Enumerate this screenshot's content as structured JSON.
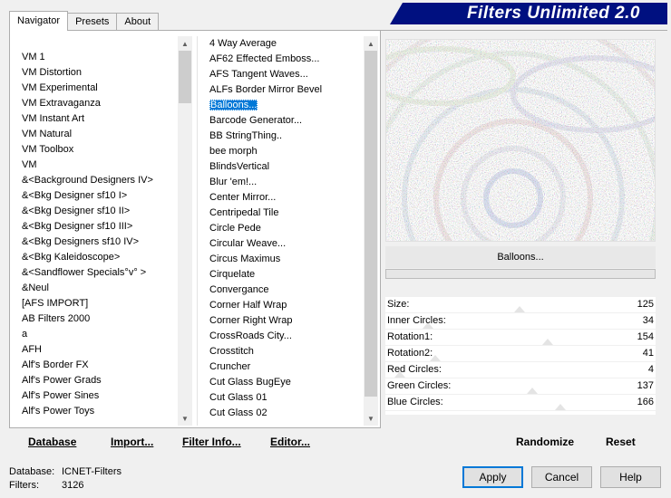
{
  "tabs": [
    "Navigator",
    "Presets",
    "About"
  ],
  "banner": "Filters Unlimited 2.0",
  "categories": [
    "VM 1",
    "VM Distortion",
    "VM Experimental",
    "VM Extravaganza",
    "VM Instant Art",
    "VM Natural",
    "VM Toolbox",
    "VM",
    "&<Background Designers IV>",
    "&<Bkg Designer sf10 I>",
    "&<Bkg Designer sf10 II>",
    "&<Bkg Designer sf10 III>",
    "&<Bkg Designers sf10 IV>",
    "&<Bkg Kaleidoscope>",
    "&<Sandflower Specials°v° >",
    "&Neul",
    "[AFS IMPORT]",
    "AB Filters 2000",
    "a",
    "AFH",
    "Alf's Border FX",
    "Alf's Power Grads",
    "Alf's Power Sines",
    "Alf's Power Toys"
  ],
  "filters": [
    "4 Way Average",
    "AF62 Effected Emboss...",
    "AFS Tangent Waves...",
    "ALFs Border Mirror Bevel",
    "Balloons...",
    "Barcode Generator...",
    "BB StringThing..",
    "bee morph",
    "BlindsVertical",
    "Blur 'em!...",
    "Center Mirror...",
    "Centripedal Tile",
    "Circle Pede",
    "Circular Weave...",
    "Circus Maximus",
    "Cirquelate",
    "Convergance",
    "Corner Half Wrap",
    "Corner Right Wrap",
    "CrossRoads City...",
    "Crosstitch",
    "Cruncher",
    "Cut Glass  BugEye",
    "Cut Glass 01",
    "Cut Glass 02"
  ],
  "selected_filter_index": 4,
  "left_buttons": {
    "database": "Database",
    "import": "Import...",
    "filter_info": "Filter Info...",
    "editor": "Editor..."
  },
  "filter_name": "Balloons...",
  "params": [
    {
      "label": "Size:",
      "value": "125",
      "level": 0.49
    },
    {
      "label": "Inner Circles:",
      "value": "34",
      "level": 0.13
    },
    {
      "label": "Rotation1:",
      "value": "154",
      "level": 0.6
    },
    {
      "label": "Rotation2:",
      "value": "41",
      "level": 0.16
    },
    {
      "label": "Red Circles:",
      "value": "4",
      "level": 0.02
    },
    {
      "label": "Green Circles:",
      "value": "137",
      "level": 0.54
    },
    {
      "label": "Blue Circles:",
      "value": "166",
      "level": 0.65
    }
  ],
  "right_buttons": {
    "randomize": "Randomize",
    "reset": "Reset"
  },
  "status": {
    "database_label": "Database:",
    "database_value": "ICNET-Filters",
    "filters_label": "Filters:",
    "filters_value": "3126"
  },
  "dialog_buttons": {
    "apply": "Apply",
    "cancel": "Cancel",
    "help": "Help"
  }
}
